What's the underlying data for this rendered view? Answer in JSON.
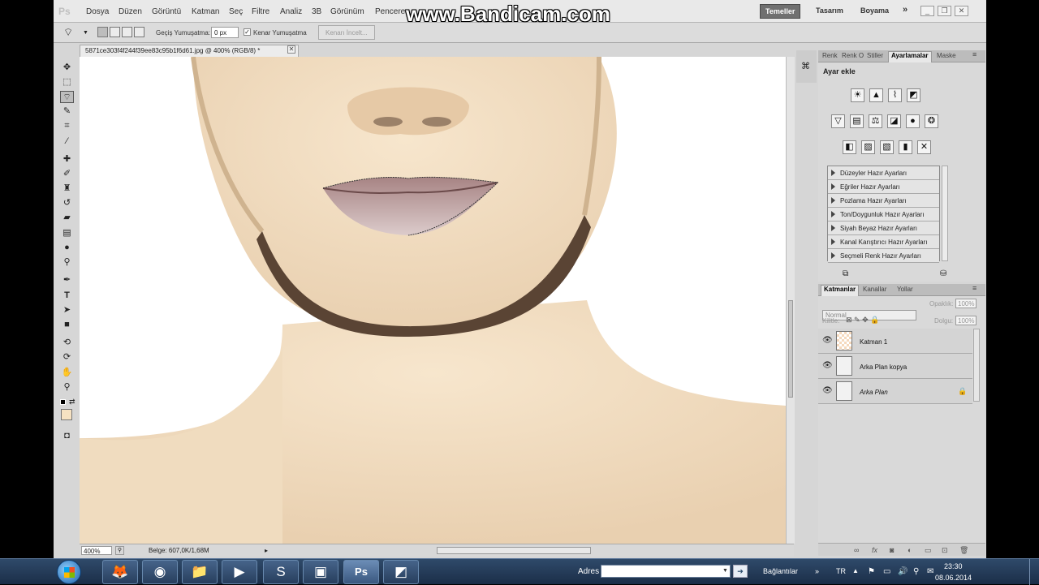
{
  "app": {
    "logo": "Ps"
  },
  "menu": [
    "Dosya",
    "Düzen",
    "Görüntü",
    "Katman",
    "Seç",
    "Filtre",
    "Analiz",
    "3B",
    "Görünüm",
    "Pencere"
  ],
  "watermark": "www.Bandicam.com",
  "workspaces": {
    "active": "Temeller",
    "others": [
      "Tasarım",
      "Boyama"
    ],
    "more": "»"
  },
  "options": {
    "feather_label": "Geçiş Yumuşatma:",
    "feather_value": "0 px",
    "antialias_label": "Kenar Yumuşatma",
    "antialias_checked": true,
    "refine_label": "Kenarı İncelt..."
  },
  "document": {
    "tab_title": "5871ce303f4f244f39ee83c95b1f6d61.jpg @ 400% (RGB/8) *",
    "zoom": "400%",
    "info": "Belge: 607,0K/1,68M"
  },
  "panels": {
    "top_tabs": [
      "Renk",
      "Renk O",
      "Stiller",
      "Ayarlamalar",
      "Maske"
    ],
    "top_active": "Ayarlamalar",
    "adjust_title": "Ayar ekle",
    "presets": [
      "Düzeyler Hazır Ayarları",
      "Eğriler Hazır Ayarları",
      "Pozlama Hazır Ayarları",
      "Ton/Doygunluk Hazır Ayarları",
      "Siyah Beyaz Hazır Ayarları",
      "Kanal Karıştırıcı Hazır Ayarları",
      "Seçmeli Renk Hazır Ayarları"
    ],
    "layer_tabs": [
      "Katmanlar",
      "Kanallar",
      "Yollar"
    ],
    "layer_active": "Katmanlar",
    "blend_mode": "Normal",
    "opacity_label": "Opaklık:",
    "opacity_value": "100%",
    "lock_label": "Kilitle:",
    "fill_label": "Dolgu:",
    "fill_value": "100%",
    "layers": [
      "Katman 1",
      "Arka Plan kopya",
      "Arka Plan"
    ]
  },
  "taskbar": {
    "address_label": "Adres",
    "links_label": "Bağlantılar",
    "lang": "TR",
    "time": "23:30",
    "date": "08.06.2014"
  }
}
